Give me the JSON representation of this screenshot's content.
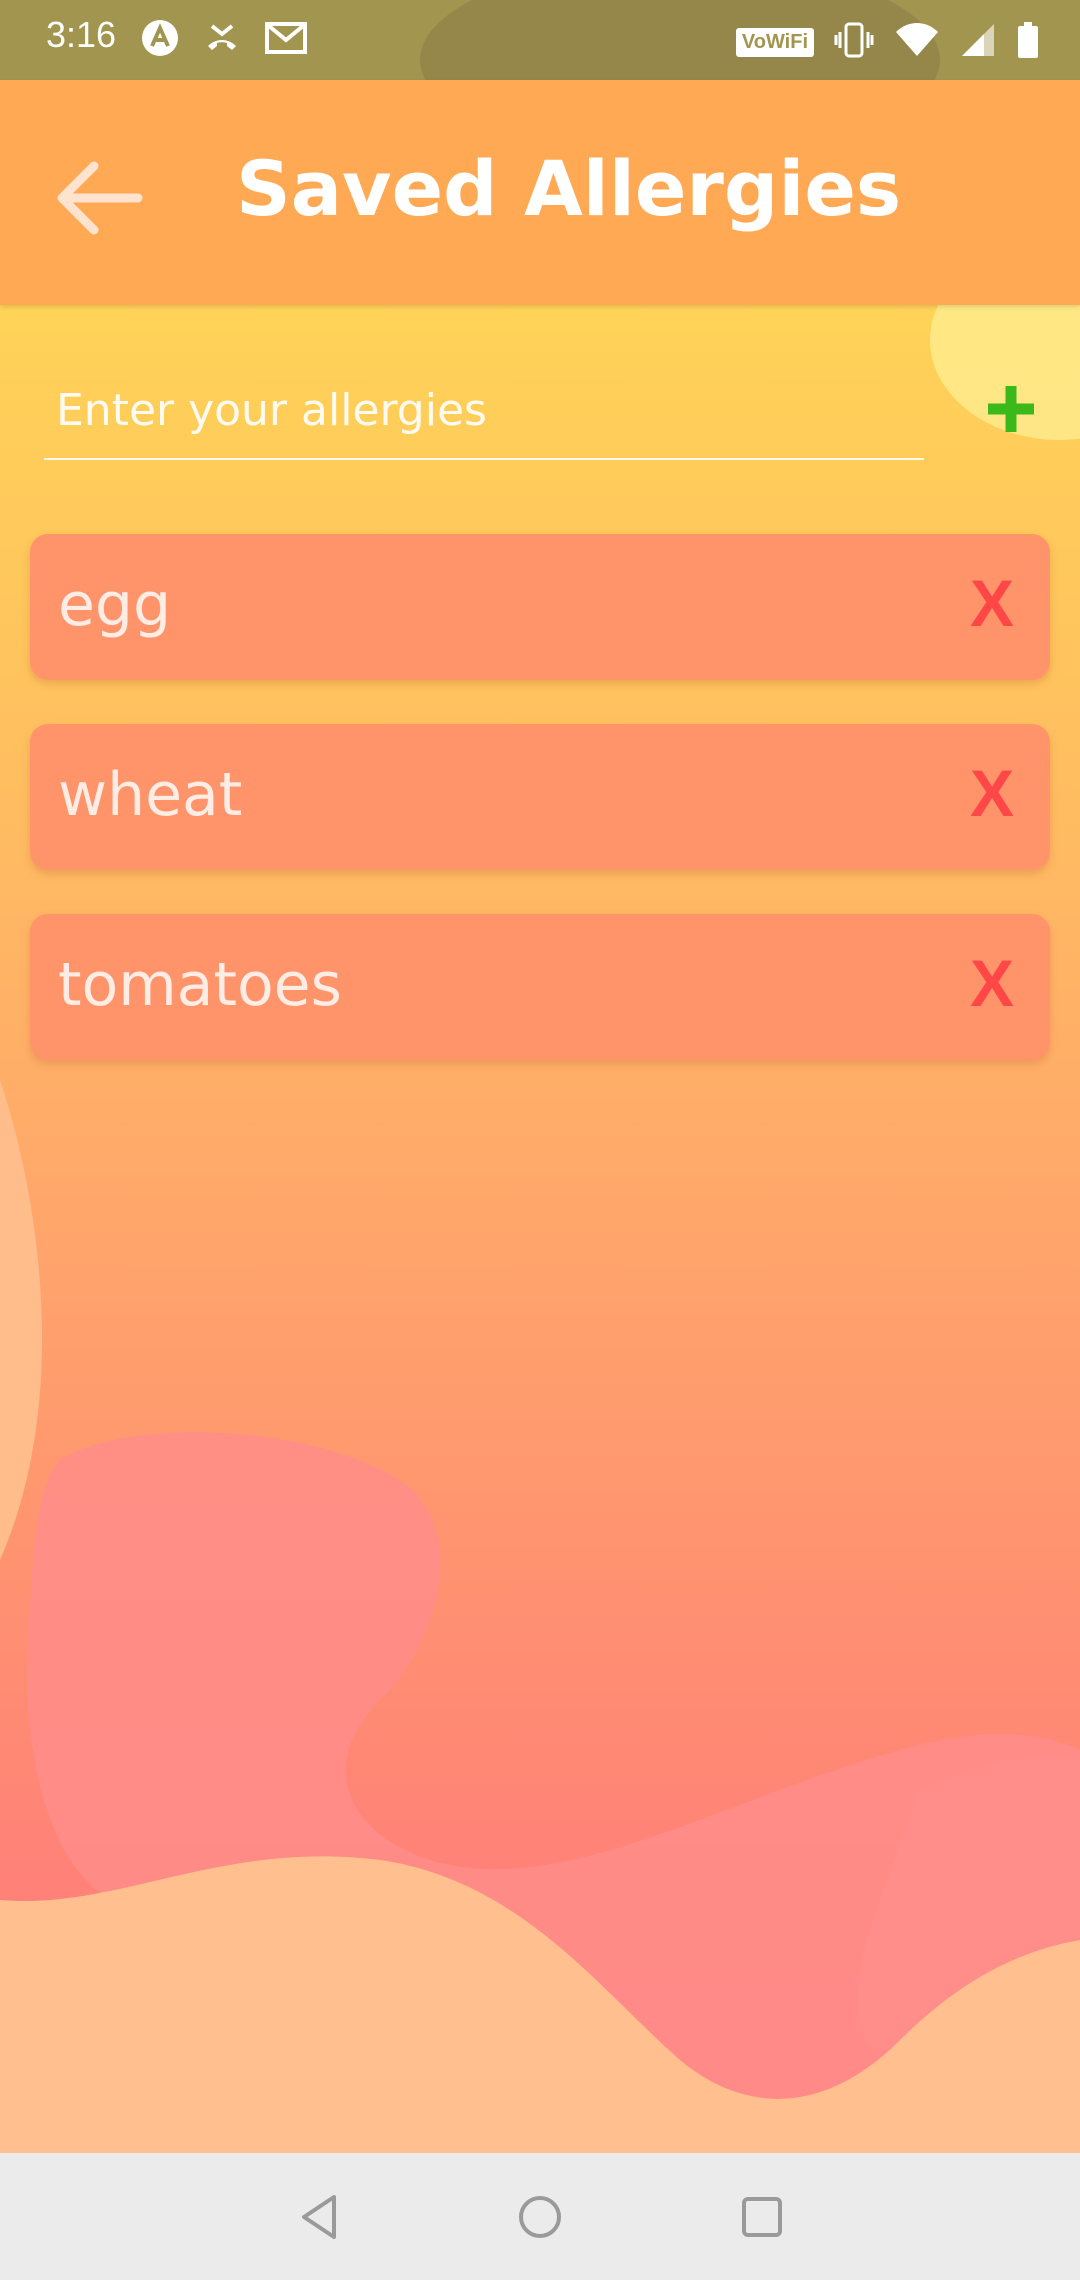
{
  "status_bar": {
    "time": "3:16",
    "left_icons": [
      "app-notification-icon",
      "missed-call-icon",
      "gmail-icon"
    ],
    "right_icons": [
      "vowifi-icon",
      "vibrate-icon",
      "wifi-icon",
      "cell-signal-icon",
      "battery-icon"
    ],
    "vowifi_label": "VoWiFi"
  },
  "app_bar": {
    "title": "Saved Allergies",
    "back_icon": "arrow-left-icon"
  },
  "input": {
    "value": "",
    "placeholder": "Enter your allergies",
    "add_icon": "plus-icon",
    "add_color": "#3cb91a"
  },
  "allergies": [
    {
      "name": "egg",
      "remove_label": "X"
    },
    {
      "name": "wheat",
      "remove_label": "X"
    },
    {
      "name": "tomatoes",
      "remove_label": "X"
    }
  ],
  "nav_bar": {
    "buttons": [
      "back-triangle-icon",
      "home-circle-icon",
      "recents-square-icon"
    ]
  },
  "colors": {
    "app_bar": "#ffa955",
    "card": "#ff946a",
    "remove": "#ff4747",
    "status_bar": "#a2954f"
  }
}
